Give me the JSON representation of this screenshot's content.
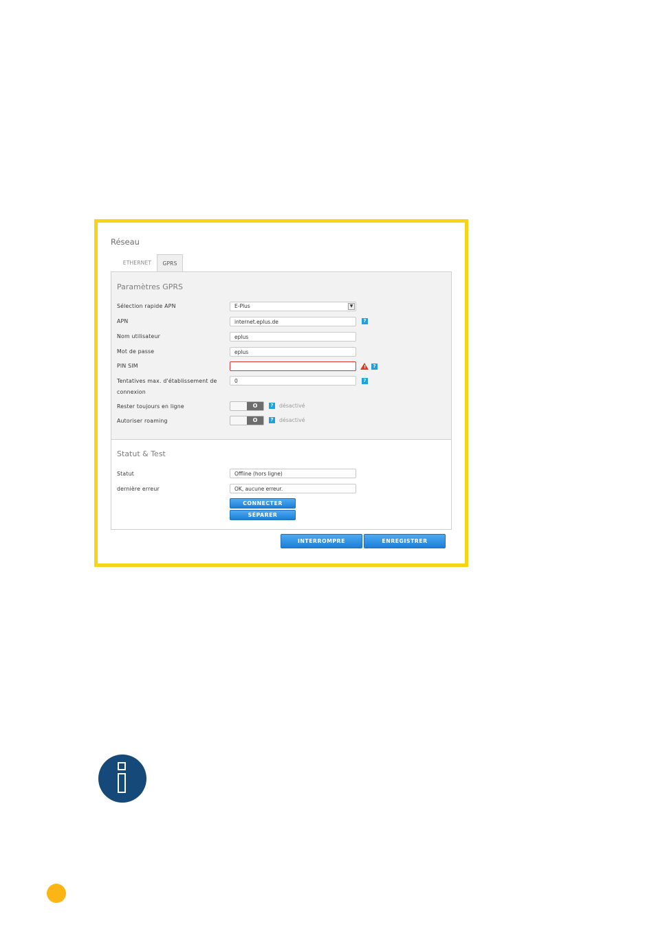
{
  "window": {
    "title": "Réseau"
  },
  "tabs": [
    {
      "label": "ETHERNET",
      "active": false
    },
    {
      "label": "GPRS",
      "active": true
    }
  ],
  "gprs": {
    "title": "Paramètres GPRS",
    "apn_select": {
      "label": "Sélection rapide APN",
      "value": "E-Plus"
    },
    "apn": {
      "label": "APN",
      "value": "internet.eplus.de"
    },
    "user": {
      "label": "Nom utilisateur",
      "value": "eplus"
    },
    "password": {
      "label": "Mot de passe",
      "value": "eplus"
    },
    "pin": {
      "label": "PIN SIM",
      "value": ""
    },
    "retries": {
      "label": "Tentatives max. d'établissement de connexion",
      "value": "0"
    },
    "always_online": {
      "label": "Rester toujours en ligne",
      "knob": "O",
      "state": "désactivé"
    },
    "roaming": {
      "label": "Autoriser roaming",
      "knob": "O",
      "state": "désactivé"
    },
    "help_glyph": "?",
    "warning_glyph": "!"
  },
  "status": {
    "title": "Statut & Test",
    "status": {
      "label": "Statut",
      "value": "Offline (hors ligne)"
    },
    "last_error": {
      "label": "dernière erreur",
      "value": "OK, aucune erreur."
    },
    "connect_label": "CONNECTER",
    "disconnect_label": "SÉPARER"
  },
  "footer": {
    "cancel_label": "INTERROMPRE",
    "save_label": "ENREGISTRER"
  },
  "colors": {
    "frame_border": "#f7d417",
    "button_blue": "#1c7fd6",
    "help_blue": "#1aa3e0",
    "error_red": "#dd3333",
    "info_navy": "#14497a",
    "accent_orange": "#fbb616"
  }
}
